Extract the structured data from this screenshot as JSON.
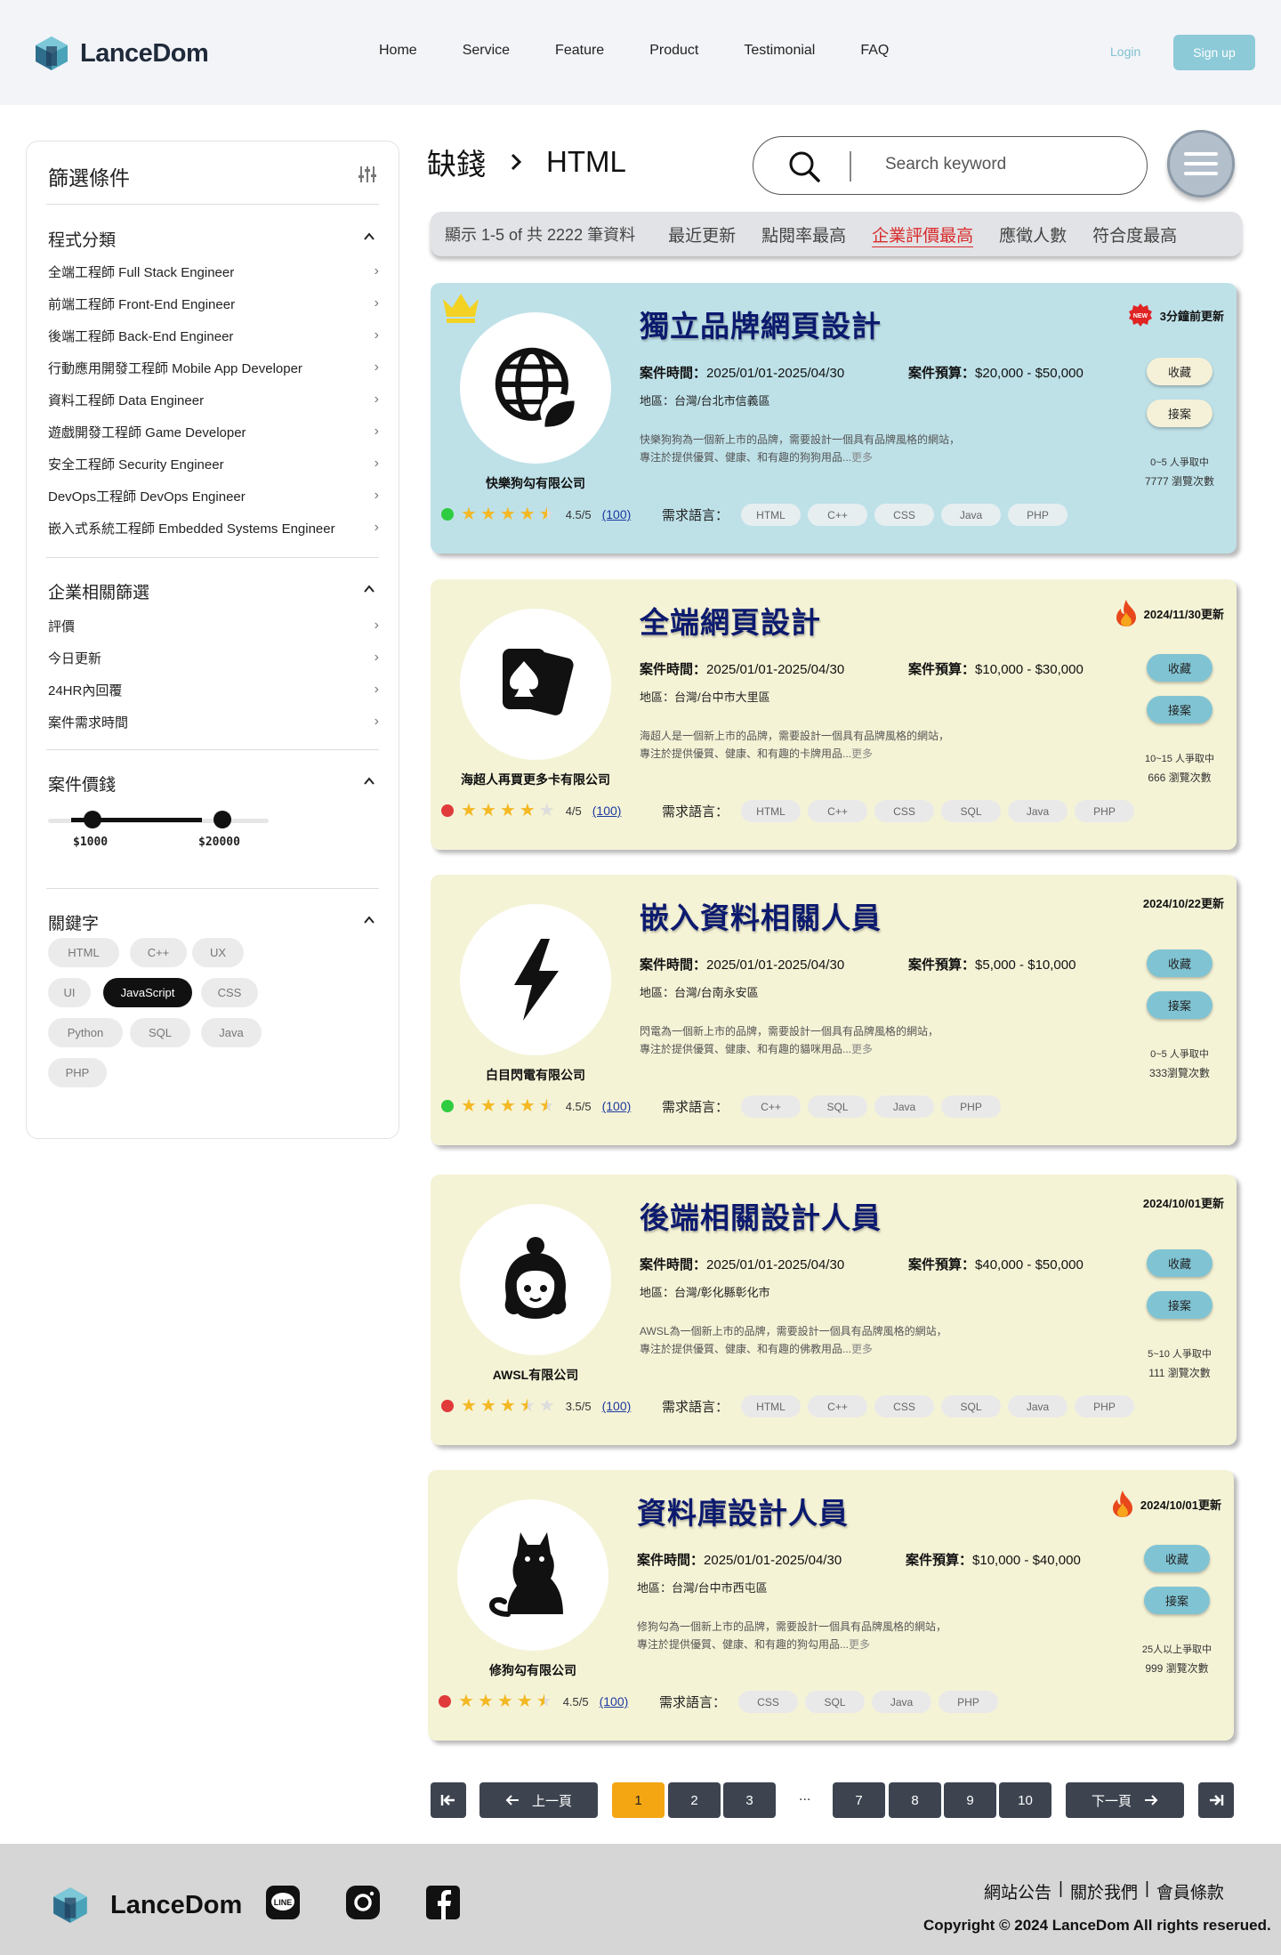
{
  "header": {
    "brand": "LanceDom",
    "nav": [
      "Home",
      "Service",
      "Feature",
      "Product",
      "Testimonial",
      "FAQ"
    ],
    "login": "Login",
    "signup": "Sign up"
  },
  "sidebar": {
    "title": "篩選條件",
    "category": {
      "heading": "程式分類",
      "items": [
        "全端工程師 Full Stack Engineer",
        "前端工程師 Front-End Engineer",
        "後端工程師 Back-End Engineer",
        "行動應用開發工程師 Mobile App Developer",
        "資料工程師 Data Engineer",
        "遊戲開發工程師 Game Developer",
        "安全工程師 Security Engineer",
        "DevOps工程師 DevOps Engineer",
        "嵌入式系統工程師 Embedded Systems Engineer"
      ]
    },
    "company": {
      "heading": "企業相關篩選",
      "items": [
        "評價",
        "今日更新",
        "24HR內回覆",
        "案件需求時間"
      ]
    },
    "price": {
      "heading": "案件價錢",
      "min_label": "$1000",
      "max_label": "$20000"
    },
    "keywords": {
      "heading": "關鍵字",
      "tags": [
        "HTML",
        "C++",
        "UX",
        "UI",
        "JavaScript",
        "CSS",
        "Python",
        "SQL",
        "Java",
        "PHP"
      ],
      "selected": "JavaScript"
    }
  },
  "breadcrumb": {
    "root": "缺錢",
    "separator": "›",
    "current": "HTML"
  },
  "search": {
    "placeholder": "Search keyword"
  },
  "sort": {
    "count": "顯示 1-5 of 共 2222 筆資料",
    "options": [
      "最近更新",
      "點閱率最高",
      "企業評價最高",
      "應徵人數",
      "符合度最高"
    ],
    "active": "企業評價最高"
  },
  "labels": {
    "period": "案件時間：",
    "budget": "案件預算：",
    "region": "地區：",
    "langs": "需求語言：",
    "more": "更多",
    "save": "收藏",
    "accept": "接案"
  },
  "jobs": [
    {
      "title": "獨立品牌網頁設計",
      "updated": "3分鐘前更新",
      "update_badge": "new",
      "period": "2025/01/01-2025/04/30",
      "budget": "$20,000 - $50,000",
      "region": "台灣/台北市信義區",
      "desc1": "快樂狗狗為一個新上市的品牌，需要設計一個具有品牌風格的網站，",
      "desc2": "專注於提供優質、健康、和有趣的狗狗用品...",
      "company": "快樂狗勾有限公司",
      "status": "green",
      "stars": 4.5,
      "rating": "4.5/5",
      "reviews": "(100)",
      "langs": [
        "HTML",
        "C++",
        "CSS",
        "Java",
        "PHP"
      ],
      "applicants": "0~5 人爭取中",
      "views": "7777 瀏覽次數",
      "icon": "globe-leaf-icon",
      "featured": true,
      "theme": "blue"
    },
    {
      "title": "全端網頁設計",
      "updated": "2024/11/30更新",
      "update_badge": "fire",
      "period": "2025/01/01-2025/04/30",
      "budget": "$10,000 - $30,000",
      "region": "台灣/台中市大里區",
      "desc1": "海超人是一個新上市的品牌，需要設計一個具有品牌風格的網站，",
      "desc2": "專注於提供優質、健康、和有趣的卡牌用品...",
      "company": "海超人再買更多卡有限公司",
      "status": "red",
      "stars": 4,
      "rating": "4/5",
      "reviews": "(100)",
      "langs": [
        "HTML",
        "C++",
        "CSS",
        "SQL",
        "Java",
        "PHP"
      ],
      "applicants": "10~15 人爭取中",
      "views": "666 瀏覽次數",
      "icon": "playing-cards-icon",
      "featured": false,
      "theme": "cream"
    },
    {
      "title": "嵌入資料相關人員",
      "updated": "2024/10/22更新",
      "update_badge": "none",
      "period": "2025/01/01-2025/04/30",
      "budget": "$5,000 - $10,000",
      "region": "台灣/台南永安區",
      "desc1": "閃電為一個新上市的品牌，需要設計一個具有品牌風格的網站，",
      "desc2": "專注於提供優質、健康、和有趣的貓咪用品...",
      "company": "白目閃電有限公司",
      "status": "green",
      "stars": 4.5,
      "rating": "4.5/5",
      "reviews": "(100)",
      "langs": [
        "C++",
        "SQL",
        "Java",
        "PHP"
      ],
      "applicants": "0~5 人爭取中",
      "views": "333瀏覽次數",
      "icon": "lightning-icon",
      "featured": false,
      "theme": "cream"
    },
    {
      "title": "後端相關設計人員",
      "updated": "2024/10/01更新",
      "update_badge": "none",
      "period": "2025/01/01-2025/04/30",
      "budget": "$40,000 - $50,000",
      "region": "台灣/彰化縣彰化市",
      "desc1": "AWSL為一個新上市的品牌，需要設計一個具有品牌風格的網站，",
      "desc2": "專注於提供優質、健康、和有趣的佛教用品...",
      "company": "AWSL有限公司",
      "status": "red",
      "stars": 3.5,
      "rating": "3.5/5",
      "reviews": "(100)",
      "langs": [
        "HTML",
        "C++",
        "CSS",
        "SQL",
        "Java",
        "PHP"
      ],
      "applicants": "5~10 人爭取中",
      "views": "111 瀏覽次數",
      "icon": "girl-face-icon",
      "featured": false,
      "theme": "cream"
    },
    {
      "title": "資料庫設計人員",
      "updated": "2024/10/01更新",
      "update_badge": "fire",
      "period": "2025/01/01-2025/04/30",
      "budget": "$10,000 - $40,000",
      "region": "台灣/台中市西屯區",
      "desc1": "修狗勾為一個新上市的品牌，需要設計一個具有品牌風格的網站，",
      "desc2": "專注於提供優質、健康、和有趣的狗勾用品...",
      "company": "修狗勾有限公司",
      "status": "red",
      "stars": 4.5,
      "rating": "4.5/5",
      "reviews": "(100)",
      "langs": [
        "CSS",
        "SQL",
        "Java",
        "PHP"
      ],
      "applicants": "25人以上爭取中",
      "views": "999 瀏覽次數",
      "icon": "cat-icon",
      "featured": false,
      "theme": "cream"
    }
  ],
  "pagination": {
    "prev": "上一頁",
    "next": "下一頁",
    "pages": [
      "1",
      "2",
      "3",
      "7",
      "8",
      "9",
      "10"
    ],
    "ellipsis": "...",
    "current": "1"
  },
  "footer": {
    "brand": "LanceDom",
    "links": [
      "網站公告",
      "關於我們",
      "會員條款"
    ],
    "copyright": "Copyright © 2024 LanceDom All rights reserued."
  }
}
